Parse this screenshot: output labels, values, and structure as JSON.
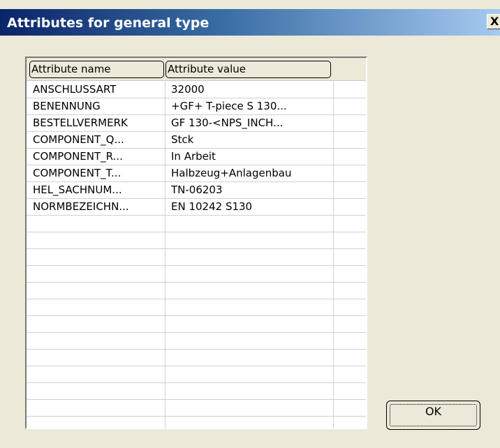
{
  "window": {
    "title": "Attributes for general type",
    "close_label": "X"
  },
  "table": {
    "columns": [
      "Attribute name",
      "Attribute value"
    ],
    "rows": [
      {
        "name": "ANSCHLUSSART",
        "value": "32000"
      },
      {
        "name": "BENENNUNG",
        "value": "+GF+ T-piece S 130..."
      },
      {
        "name": "BESTELLVERMERK",
        "value": "GF 130-<NPS_INCH..."
      },
      {
        "name": "COMPONENT_Q...",
        "value": "Stck"
      },
      {
        "name": "COMPONENT_R...",
        "value": "In Arbeit"
      },
      {
        "name": "COMPONENT_T...",
        "value": "Halbzeug+Anlagenbau"
      },
      {
        "name": "HEL_SACHNUM...",
        "value": "TN-06203"
      },
      {
        "name": "NORMBEZEICHN...",
        "value": "EN 10242 S130"
      }
    ]
  },
  "buttons": {
    "ok_label": "OK"
  }
}
